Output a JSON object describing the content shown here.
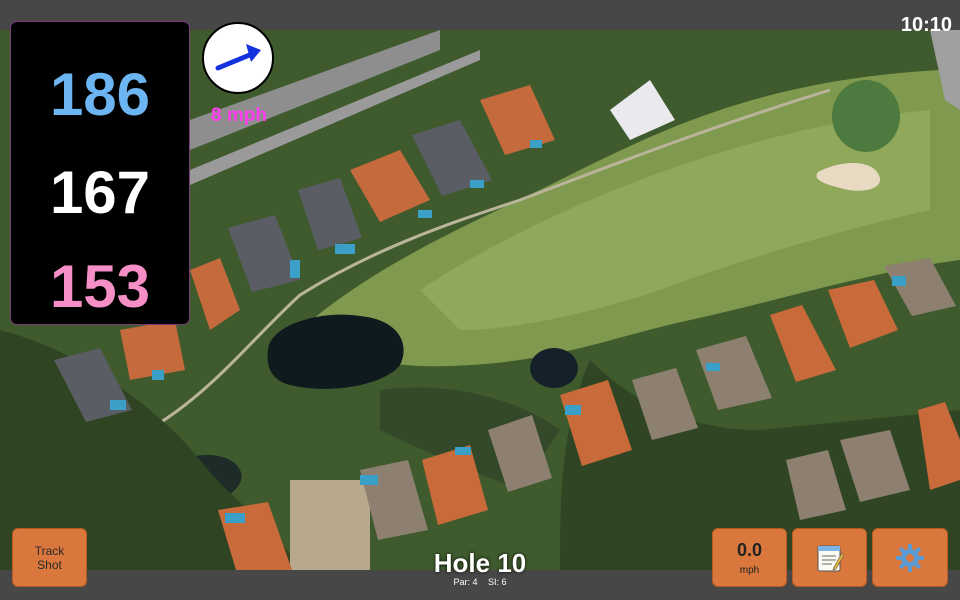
{
  "clock": "10:10",
  "distances": {
    "back": "186",
    "center": "167",
    "front": "153"
  },
  "wind": {
    "speed_label": "8 mph",
    "direction_icon": "wind-arrow-icon"
  },
  "buttons": {
    "track_line1": "Track",
    "track_line2": "Shot",
    "wind_value": "0.0",
    "wind_unit": "mph",
    "notes_icon": "notepad-icon",
    "settings_icon": "gear-icon"
  },
  "hole": {
    "title": "Hole 10",
    "par": "Par: 4",
    "si": "SI: 6"
  },
  "colors": {
    "back": "#6db4f2",
    "center": "#ffffff",
    "front": "#f58fc6",
    "wind_text": "#ff3df0",
    "button": "#d9773d"
  }
}
